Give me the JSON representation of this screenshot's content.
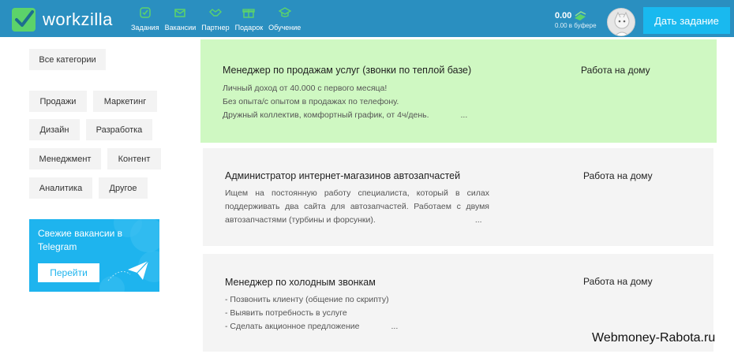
{
  "header": {
    "logo_text": "workzilla",
    "nav": [
      {
        "label": "Задания",
        "icon": "tasks-icon"
      },
      {
        "label": "Вакансии",
        "icon": "mail-icon"
      },
      {
        "label": "Партнер",
        "icon": "handshake-icon"
      },
      {
        "label": "Подарок",
        "icon": "gift-icon"
      },
      {
        "label": "Обучение",
        "icon": "graduation-cap-icon"
      }
    ],
    "balance": "0.00",
    "buffer": "0.00 в буфере",
    "cta_label": "Дать задание",
    "colors": {
      "bar": "#2a8fc0",
      "accent": "#5cd36a",
      "cta": "#19b9ef"
    }
  },
  "sidebar": {
    "all_categories": "Все категории",
    "categories": [
      "Продажи",
      "Маркетинг",
      "Дизайн",
      "Разработка",
      "Менеджмент",
      "Контент",
      "Аналитика",
      "Другое"
    ],
    "telegram": {
      "title": "Свежие вакансии в Telegram",
      "button": "Перейти",
      "icon": "paper-plane-icon"
    }
  },
  "jobs": [
    {
      "title": "Менеджер по продажам услуг (звонки по теплой базе)",
      "lines": [
        "Личный доход от 40.000 с первого месяца!",
        "Без опыта/с опытом в продажах по телефону.",
        "Дружный коллектив, комфортный график, от 4ч/день."
      ],
      "more": "...",
      "location": "Работа на дому",
      "highlight": true
    },
    {
      "title": "Администратор интернет-магазинов автозапчастей",
      "lines": [
        "Ищем на постоянную работу специалиста, который в силах",
        "поддерживать два сайта для автозапчастей. Работаем с двумя",
        "автозапчастями (турбины и форсунки)."
      ],
      "more": "...",
      "location": "Работа на дому",
      "highlight": false
    },
    {
      "title": "Менеджер по холодным звонкам",
      "lines": [
        "- Позвонить клиенту (общение по скрипту)",
        "- Выявить потребность в услуге",
        "- Сделать акционное предложение"
      ],
      "more": "...",
      "location": "Работа на дому",
      "highlight": false
    }
  ],
  "watermark": "Webmoney-Rabota.ru"
}
